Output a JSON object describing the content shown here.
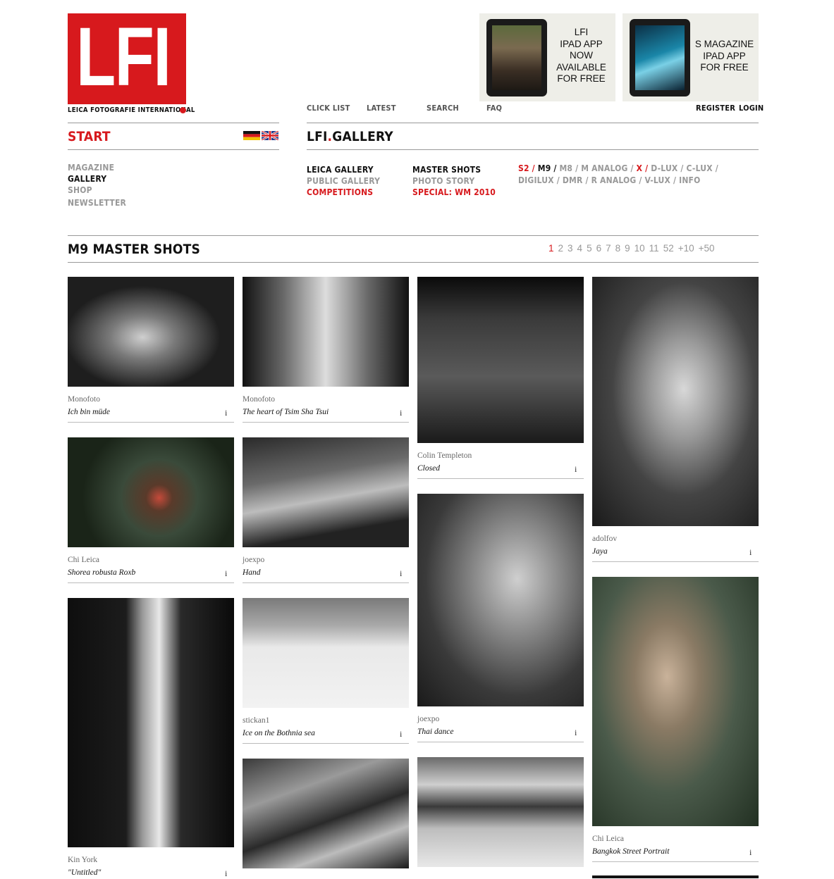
{
  "logo": {
    "letters": "LFI",
    "subtitle": "LEICA FOTOGRAFIE INTERNATIONAL"
  },
  "ads": [
    {
      "text": "LFI\nIPAD APP\nNOW\nAVAILABLE\nFOR FREE"
    },
    {
      "text": "S MAGAZINE\nIPAD APP\nFOR FREE"
    }
  ],
  "top_nav": {
    "click_list": "CLICK LIST",
    "latest": "LATEST",
    "search": "SEARCH",
    "faq": "FAQ",
    "register": "REGISTER",
    "login": "LOGIN"
  },
  "start": "START",
  "gallery_title_a": "LFI",
  "gallery_title_b": "GALLERY",
  "sidebar": {
    "items": [
      {
        "label": "MAGAZINE"
      },
      {
        "label": "GALLERY"
      },
      {
        "label": "SHOP"
      },
      {
        "label": "NEWSLETTER"
      }
    ]
  },
  "subnav": {
    "col1": [
      "LEICA GALLERY",
      "PUBLIC GALLERY",
      "COMPETITIONS"
    ],
    "col2": [
      "MASTER SHOTS",
      "PHOTO STORY",
      "SPECIAL: WM 2010"
    ]
  },
  "cameras": {
    "s2": "S2",
    "m9": "M9",
    "m8": "M8",
    "m_analog": "M ANALOG",
    "x": "X",
    "d_lux": "D-LUX",
    "c_lux": "C-LUX",
    "digilux": "DIGILUX",
    "dmr": "DMR",
    "r_analog": "R ANALOG",
    "v_lux": "V-LUX",
    "info": "INFO"
  },
  "section_title": "M9 MASTER SHOTS",
  "pager": [
    "1",
    "2",
    "3",
    "4",
    "5",
    "6",
    "7",
    "8",
    "9",
    "10",
    "11",
    "52",
    "+10",
    "+50"
  ],
  "photos": [
    {
      "author": "Monofoto",
      "title": "Ich bin müde",
      "info": "i"
    },
    {
      "author": "Monofoto",
      "title": "The heart of Tsim Sha Tsui",
      "info": "i"
    },
    {
      "author": "Colin Templeton",
      "title": "Closed",
      "info": "i"
    },
    {
      "author": "adolfov",
      "title": "Jaya",
      "info": "i"
    },
    {
      "author": "Chi Leica",
      "title": "Shorea robusta Roxb",
      "info": "i"
    },
    {
      "author": "joexpo",
      "title": "Hand",
      "info": "i"
    },
    {
      "author": "joexpo",
      "title": "Thai dance",
      "info": "i"
    },
    {
      "author": "Chi Leica",
      "title": "Bangkok Street Portrait",
      "info": "i"
    },
    {
      "author": "Kin York",
      "title": "\"Untitled\"",
      "info": "i"
    },
    {
      "author": "stickan1",
      "title": "Ice on the Bothnia sea",
      "info": "i"
    }
  ],
  "colors": {
    "brand_red": "#d7191d",
    "rule": "#999999"
  }
}
